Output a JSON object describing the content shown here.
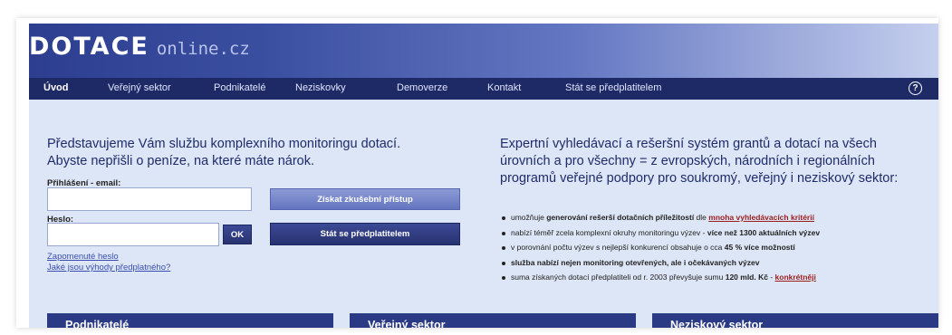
{
  "logo": {
    "main": "DOTACE",
    "sub": "online.cz"
  },
  "nav": {
    "items": [
      {
        "label": "Úvod"
      },
      {
        "label": "Veřejný sektor"
      },
      {
        "label": "Podnikatelé"
      },
      {
        "label": "Neziskovky"
      },
      {
        "label": "Demoverze"
      },
      {
        "label": "Kontakt"
      },
      {
        "label": "Stát se předplatitelem"
      }
    ],
    "help_label": "?"
  },
  "intro": {
    "line1": "Představujeme Vám službu komplexního monitoringu dotací.",
    "line2": "Abyste nepřišli o peníze, na které máte nárok."
  },
  "login": {
    "email_label": "Přihlášení - email:",
    "email_value": "",
    "password_label": "Heslo:",
    "password_value": "",
    "ok_label": "OK",
    "trial_button": "Získat zkušební přístup",
    "subscribe_button": "Stát se předplatitelem",
    "forgot_link": "Zapomenuté heslo",
    "benefits_link": "Jaké jsou výhody předplatného?"
  },
  "expert": {
    "line1": "Expertní vyhledávací a rešeršní systém grantů a dotací na všech",
    "line2": "úrovních a pro všechny = z evropských, národních i regionálních",
    "line3": "programů veřejné podpory pro soukromý, veřejný i neziskový sektor:"
  },
  "bullets": {
    "b1_pre": "umožňuje ",
    "b1_bold": "generování rešerší dotačních příležitostí",
    "b1_mid": " dle ",
    "b1_link": "mnoha vyhledávacích kritérií",
    "b2_pre": "nabízí téměř zcela komplexní okruhy monitoringu výzev - ",
    "b2_bold": "více než 1300 aktuálních výzev",
    "b3_pre": "v porovnání počtu výzev s nejlepší konkurencí obsahuje o cca ",
    "b3_bold": "45 % více možností",
    "b4_bold": "služba nabízí nejen monitoring otevřených, ale i očekávaných výzev",
    "b5_pre": "suma získaných dotací předplatiteli od r. 2003 převyšuje sumu ",
    "b5_bold": "120 mld. Kč",
    "b5_mid": " - ",
    "b5_link": "konkrétněji"
  },
  "sections": {
    "s1": "Podnikatelé",
    "s2": "Veřejný sektor",
    "s3": "Neziskový sektor"
  },
  "colors": {
    "nav_bg": "#1e2a66",
    "content_bg": "#dde6f6",
    "section_bar": "#2a3a85",
    "link_red": "#9b1c1c"
  }
}
